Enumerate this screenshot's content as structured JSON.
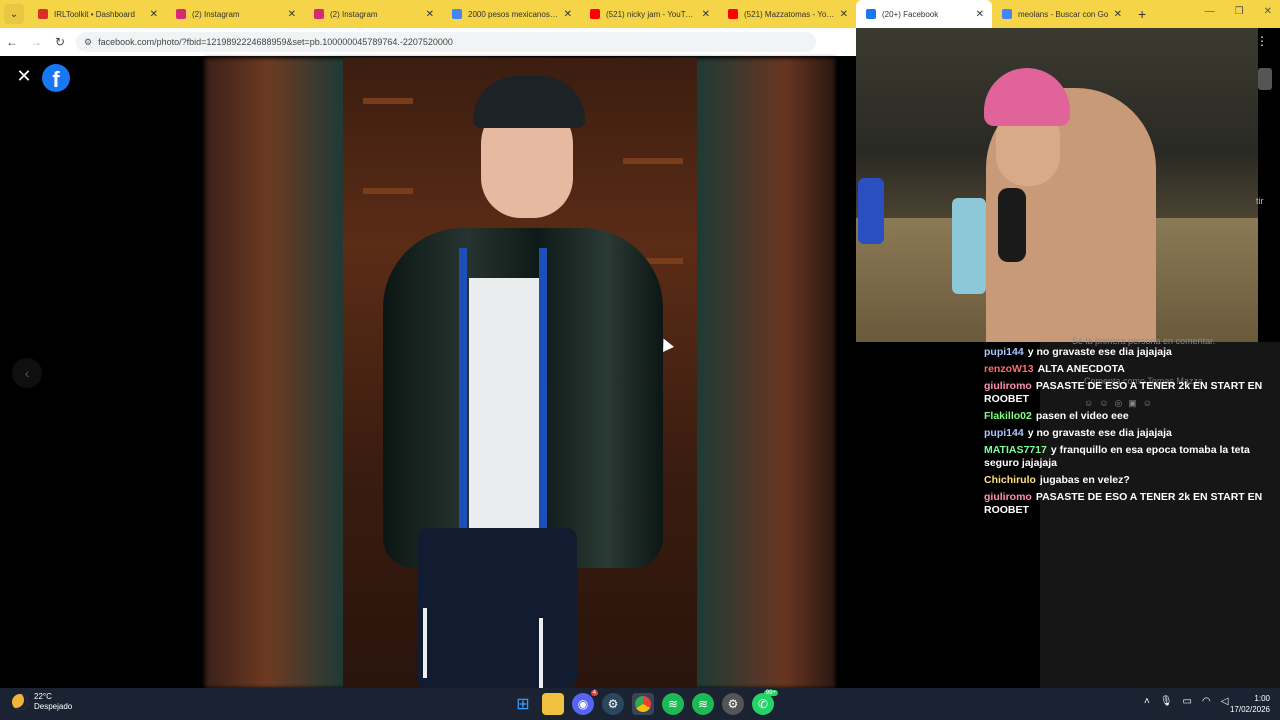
{
  "browser": {
    "tabs": [
      {
        "title": "IRLToolkit • Dashboard",
        "color": "#d93025"
      },
      {
        "title": "(2) Instagram",
        "color": "#d62976"
      },
      {
        "title": "(2) Instagram",
        "color": "#d62976"
      },
      {
        "title": "2000 pesos mexicanos a a",
        "color": "#4285f4"
      },
      {
        "title": "(521) nicky jam - YouTube",
        "color": "#ff0000"
      },
      {
        "title": "(521) Mazzatomas - YouTu",
        "color": "#ff0000"
      },
      {
        "title": "(20+) Facebook",
        "color": "#1877f2",
        "active": true
      },
      {
        "title": "meolans - Buscar con Go",
        "color": "#4285f4"
      }
    ],
    "url": "facebook.com/photo/?fbid=1219892224688959&set=pb.100000045789764.-2207520000"
  },
  "chat": {
    "ghost_text": "Sé la primera persona en comentar.",
    "ghost_text2": "Comenta como Tomas Mazza",
    "messages": [
      {
        "user": "pupi144",
        "color": "#a9c4ff",
        "text": "y no gravaste ese dia jajajaja"
      },
      {
        "user": "renzoW13",
        "color": "#ff6b6b",
        "text": "ALTA ANECDOTA"
      },
      {
        "user": "giuliromo",
        "color": "#ff8fb0",
        "text": "PASASTE DE ESO A TENER 2k EN START EN ROOBET"
      },
      {
        "user": "Flakillo02",
        "color": "#7dff7d",
        "text": "pasen el video eee"
      },
      {
        "user": "pupi144",
        "color": "#a9c4ff",
        "text": "y no gravaste ese dia jajajaja"
      },
      {
        "user": "MATIAS7717",
        "color": "#7dff9d",
        "text": "y franquillo en esa epoca tomaba la teta seguro jajajaja"
      },
      {
        "user": "Chichirulo",
        "color": "#ffe080",
        "text": "jugabas en velez?"
      },
      {
        "user": "giuliromo",
        "color": "#ff8fb0",
        "text": "PASASTE DE ESO A TENER 2k EN START EN ROOBET"
      }
    ],
    "edge_text": "tir"
  },
  "taskbar": {
    "temp": "22°C",
    "weather": "Despejado",
    "time": "1:00",
    "date": "17/02/2026",
    "discord_badge": "4",
    "whatsapp_badge": "99+"
  }
}
